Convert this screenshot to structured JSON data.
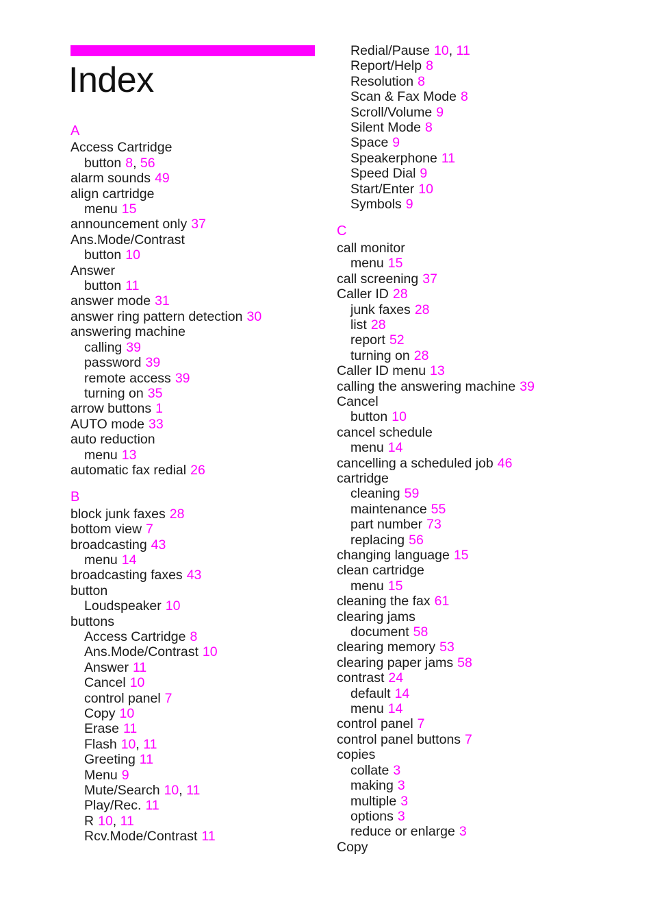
{
  "document": {
    "title": "Index",
    "accent_color": "#ff00ff",
    "text_color": "#1a1a1a",
    "background_color": "#ffffff"
  },
  "columns": {
    "left": {
      "blocks": [
        {
          "letter": "A",
          "entries": [
            {
              "level": 1,
              "term": "Access Cartridge",
              "pages": []
            },
            {
              "level": 2,
              "term": "button",
              "pages": [
                "8",
                "56"
              ]
            },
            {
              "level": 1,
              "term": "alarm sounds",
              "pages": [
                "49"
              ]
            },
            {
              "level": 1,
              "term": "align cartridge",
              "pages": []
            },
            {
              "level": 2,
              "term": "menu",
              "pages": [
                "15"
              ]
            },
            {
              "level": 1,
              "term": "announcement only",
              "pages": [
                "37"
              ]
            },
            {
              "level": 1,
              "term": "Ans.Mode/Contrast",
              "pages": []
            },
            {
              "level": 2,
              "term": "button",
              "pages": [
                "10"
              ]
            },
            {
              "level": 1,
              "term": "Answer",
              "pages": []
            },
            {
              "level": 2,
              "term": "button",
              "pages": [
                "11"
              ]
            },
            {
              "level": 1,
              "term": "answer mode",
              "pages": [
                "31"
              ]
            },
            {
              "level": 1,
              "term": "answer ring pattern detection",
              "pages": [
                "30"
              ]
            },
            {
              "level": 1,
              "term": "answering machine",
              "pages": []
            },
            {
              "level": 2,
              "term": "calling",
              "pages": [
                "39"
              ]
            },
            {
              "level": 2,
              "term": "password",
              "pages": [
                "39"
              ]
            },
            {
              "level": 2,
              "term": "remote access",
              "pages": [
                "39"
              ]
            },
            {
              "level": 2,
              "term": "turning on",
              "pages": [
                "35"
              ]
            },
            {
              "level": 1,
              "term": "arrow buttons",
              "pages": [
                "1"
              ]
            },
            {
              "level": 1,
              "term": "AUTO mode",
              "pages": [
                "33"
              ]
            },
            {
              "level": 1,
              "term": "auto reduction",
              "pages": []
            },
            {
              "level": 2,
              "term": "menu",
              "pages": [
                "13"
              ]
            },
            {
              "level": 1,
              "term": "automatic fax redial",
              "pages": [
                "26"
              ]
            }
          ]
        },
        {
          "letter": "B",
          "entries": [
            {
              "level": 1,
              "term": "block junk faxes",
              "pages": [
                "28"
              ]
            },
            {
              "level": 1,
              "term": "bottom view",
              "pages": [
                "7"
              ]
            },
            {
              "level": 1,
              "term": "broadcasting",
              "pages": [
                "43"
              ]
            },
            {
              "level": 2,
              "term": "menu",
              "pages": [
                "14"
              ]
            },
            {
              "level": 1,
              "term": "broadcasting faxes",
              "pages": [
                "43"
              ]
            },
            {
              "level": 1,
              "term": "button",
              "pages": []
            },
            {
              "level": 2,
              "term": "Loudspeaker",
              "pages": [
                "10"
              ]
            },
            {
              "level": 1,
              "term": "buttons",
              "pages": []
            },
            {
              "level": 2,
              "term": "Access Cartridge",
              "pages": [
                "8"
              ]
            },
            {
              "level": 2,
              "term": "Ans.Mode/Contrast",
              "pages": [
                "10"
              ]
            },
            {
              "level": 2,
              "term": "Answer",
              "pages": [
                "11"
              ]
            },
            {
              "level": 2,
              "term": "Cancel",
              "pages": [
                "10"
              ]
            },
            {
              "level": 2,
              "term": "control panel",
              "pages": [
                "7"
              ]
            },
            {
              "level": 2,
              "term": "Copy",
              "pages": [
                "10"
              ]
            },
            {
              "level": 2,
              "term": "Erase",
              "pages": [
                "11"
              ]
            },
            {
              "level": 2,
              "term": "Flash",
              "pages": [
                "10",
                "11"
              ]
            },
            {
              "level": 2,
              "term": "Greeting",
              "pages": [
                "11"
              ]
            },
            {
              "level": 2,
              "term": "Menu",
              "pages": [
                "9"
              ]
            },
            {
              "level": 2,
              "term": "Mute/Search",
              "pages": [
                "10",
                "11"
              ]
            },
            {
              "level": 2,
              "term": "Play/Rec.",
              "pages": [
                "11"
              ]
            },
            {
              "level": 2,
              "term": "R",
              "pages": [
                "10",
                "11"
              ]
            },
            {
              "level": 2,
              "term": "Rcv.Mode/Contrast",
              "pages": [
                "11"
              ]
            }
          ]
        }
      ]
    },
    "right": {
      "blocks": [
        {
          "letter": "",
          "entries": [
            {
              "level": 2,
              "term": "Redial/Pause",
              "pages": [
                "10",
                "11"
              ]
            },
            {
              "level": 2,
              "term": "Report/Help",
              "pages": [
                "8"
              ]
            },
            {
              "level": 2,
              "term": "Resolution",
              "pages": [
                "8"
              ]
            },
            {
              "level": 2,
              "term": "Scan & Fax Mode",
              "pages": [
                "8"
              ]
            },
            {
              "level": 2,
              "term": "Scroll/Volume",
              "pages": [
                "9"
              ]
            },
            {
              "level": 2,
              "term": "Silent Mode",
              "pages": [
                "8"
              ]
            },
            {
              "level": 2,
              "term": "Space",
              "pages": [
                "9"
              ]
            },
            {
              "level": 2,
              "term": "Speakerphone",
              "pages": [
                "11"
              ]
            },
            {
              "level": 2,
              "term": "Speed Dial",
              "pages": [
                "9"
              ]
            },
            {
              "level": 2,
              "term": "Start/Enter",
              "pages": [
                "10"
              ]
            },
            {
              "level": 2,
              "term": "Symbols",
              "pages": [
                "9"
              ]
            }
          ]
        },
        {
          "letter": "C",
          "entries": [
            {
              "level": 1,
              "term": "call monitor",
              "pages": []
            },
            {
              "level": 2,
              "term": "menu",
              "pages": [
                "15"
              ]
            },
            {
              "level": 1,
              "term": "call screening",
              "pages": [
                "37"
              ]
            },
            {
              "level": 1,
              "term": "Caller ID",
              "pages": [
                "28"
              ]
            },
            {
              "level": 2,
              "term": "junk faxes",
              "pages": [
                "28"
              ]
            },
            {
              "level": 2,
              "term": "list",
              "pages": [
                "28"
              ]
            },
            {
              "level": 2,
              "term": "report",
              "pages": [
                "52"
              ]
            },
            {
              "level": 2,
              "term": "turning on",
              "pages": [
                "28"
              ]
            },
            {
              "level": 1,
              "term": "Caller ID menu",
              "pages": [
                "13"
              ]
            },
            {
              "level": 1,
              "term": "calling the answering machine",
              "pages": [
                "39"
              ]
            },
            {
              "level": 1,
              "term": "Cancel",
              "pages": []
            },
            {
              "level": 2,
              "term": "button",
              "pages": [
                "10"
              ]
            },
            {
              "level": 1,
              "term": "cancel schedule",
              "pages": []
            },
            {
              "level": 2,
              "term": "menu",
              "pages": [
                "14"
              ]
            },
            {
              "level": 1,
              "term": "cancelling a scheduled job",
              "pages": [
                "46"
              ]
            },
            {
              "level": 1,
              "term": "cartridge",
              "pages": []
            },
            {
              "level": 2,
              "term": "cleaning",
              "pages": [
                "59"
              ]
            },
            {
              "level": 2,
              "term": "maintenance",
              "pages": [
                "55"
              ]
            },
            {
              "level": 2,
              "term": "part number",
              "pages": [
                "73"
              ]
            },
            {
              "level": 2,
              "term": "replacing",
              "pages": [
                "56"
              ]
            },
            {
              "level": 1,
              "term": "changing language",
              "pages": [
                "15"
              ]
            },
            {
              "level": 1,
              "term": "clean cartridge",
              "pages": []
            },
            {
              "level": 2,
              "term": "menu",
              "pages": [
                "15"
              ]
            },
            {
              "level": 1,
              "term": "cleaning the fax",
              "pages": [
                "61"
              ]
            },
            {
              "level": 1,
              "term": "clearing jams",
              "pages": []
            },
            {
              "level": 2,
              "term": "document",
              "pages": [
                "58"
              ]
            },
            {
              "level": 1,
              "term": "clearing memory",
              "pages": [
                "53"
              ]
            },
            {
              "level": 1,
              "term": "clearing paper jams",
              "pages": [
                "58"
              ]
            },
            {
              "level": 1,
              "term": "contrast",
              "pages": [
                "24"
              ]
            },
            {
              "level": 2,
              "term": "default",
              "pages": [
                "14"
              ]
            },
            {
              "level": 2,
              "term": "menu",
              "pages": [
                "14"
              ]
            },
            {
              "level": 1,
              "term": "control panel",
              "pages": [
                "7"
              ]
            },
            {
              "level": 1,
              "term": "control panel buttons",
              "pages": [
                "7"
              ]
            },
            {
              "level": 1,
              "term": "copies",
              "pages": []
            },
            {
              "level": 2,
              "term": "collate",
              "pages": [
                "3"
              ]
            },
            {
              "level": 2,
              "term": "making",
              "pages": [
                "3"
              ]
            },
            {
              "level": 2,
              "term": "multiple",
              "pages": [
                "3"
              ]
            },
            {
              "level": 2,
              "term": "options",
              "pages": [
                "3"
              ]
            },
            {
              "level": 2,
              "term": "reduce or enlarge",
              "pages": [
                "3"
              ]
            },
            {
              "level": 1,
              "term": "Copy",
              "pages": []
            }
          ]
        }
      ]
    }
  }
}
